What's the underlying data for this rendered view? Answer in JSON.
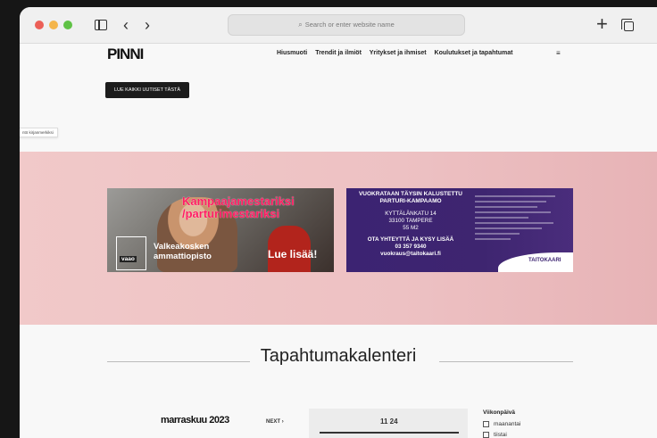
{
  "browser": {
    "address_placeholder": "Search or enter website name",
    "new_tab_symbol": "+"
  },
  "site": {
    "logo": "PINNI",
    "nav": [
      "Hiusmuoti",
      "Trendit ja ilmiöt",
      "Yritykset ja ihmiset",
      "Koulutukset ja tapahtumat"
    ],
    "menu_symbol": "≡",
    "news_button": "LUE KAIKKI UUTISET TÄSTÄ",
    "bookmark_tooltip": "ntö kirjanmerkiksi"
  },
  "ads": {
    "ad1": {
      "headline_1": "Kampaajamestariksi",
      "headline_2": "/parturimestariksi",
      "logo_text": "vaao",
      "school_1": "Valkeakosken",
      "school_2": "ammattiopisto",
      "cta": "Lue lisää!"
    },
    "ad2": {
      "title_1": "VUOKRATAAN TÄYSIN KALUSTETTU",
      "title_2": "PARTURI-KAMPAAMO",
      "address_1": "KYTTÄLÄNKATU 14",
      "address_2": "33100 TAMPERE",
      "area": "55 M2",
      "contact_title": "OTA YHTEYTTÄ JA KYSY LISÄÄ",
      "phone": "03 357 9340",
      "email": "vuokraus@taitokaari.fi",
      "brand": "TAITOKAARI"
    }
  },
  "calendar": {
    "heading": "Tapahtumakalenteri",
    "month": "marraskuu 2023",
    "next_label": "NEXT",
    "time_label": "11 24",
    "weekday_header": "Viikonpäivä",
    "weekday_options": [
      "maanantai",
      "tiistai"
    ]
  },
  "colors": {
    "band": "#edc1c3",
    "ad2_bg": "#3c2372",
    "ad1_headline": "#ff1d63"
  }
}
